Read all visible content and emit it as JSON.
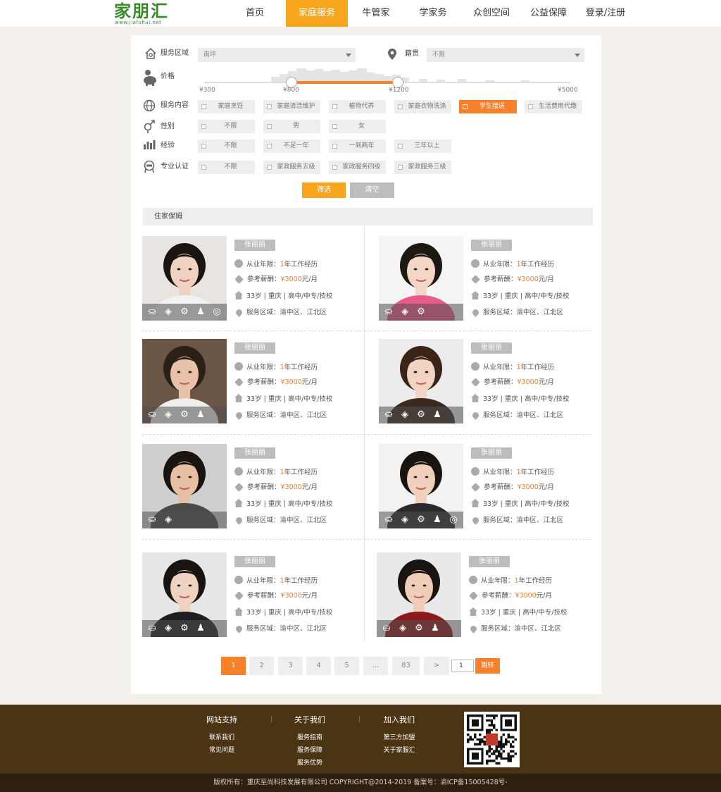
{
  "header": {
    "logo_text": "家朋汇",
    "logo_url": "www.jiafuhui.net",
    "nav": [
      {
        "label": "首页",
        "active": false
      },
      {
        "label": "家庭服务",
        "active": true
      },
      {
        "label": "牛管家",
        "active": false
      },
      {
        "label": "学家务",
        "active": false
      },
      {
        "label": "众创空间",
        "active": false
      },
      {
        "label": "公益保障",
        "active": false
      },
      {
        "label": "登录/注册",
        "active": false
      }
    ]
  },
  "filters": {
    "area": {
      "label": "服务区域",
      "value": "南坪"
    },
    "origin": {
      "label": "籍贯",
      "value": "不限"
    },
    "price": {
      "label": "价格",
      "ticks": [
        "¥300",
        "¥800",
        "¥1200",
        "¥5000"
      ],
      "min": 300,
      "max": 5000,
      "low": 800,
      "high": 1200
    },
    "content": {
      "label": "服务内容",
      "options": [
        "家庭烹饪",
        "家庭清洁维护",
        "植物代养",
        "家庭衣物洗涤",
        "学生接送",
        "生活费用代缴"
      ],
      "selected": "学生接送"
    },
    "gender": {
      "label": "性别",
      "options": [
        "不限",
        "男",
        "女"
      ]
    },
    "experience": {
      "label": "经验",
      "options": [
        "不限",
        "不足一年",
        "一到两年",
        "三年以上"
      ]
    },
    "certification": {
      "label": "专业认证",
      "options": [
        "不限",
        "家政服务五级",
        "家政服务四级",
        "家政服务三级"
      ]
    },
    "filter_button": "筛选",
    "clear_button": "清空"
  },
  "section_title": "住家保姆",
  "labels": {
    "years_prefix": "从业年限：",
    "years_value": "1",
    "years_suffix": "年工作经历",
    "salary_prefix": "参考薪酬：",
    "salary_value": "¥3000",
    "salary_suffix": "元/月",
    "profile": "33岁 | 重庆 | 高中/中专/技校",
    "area_prefix": "服务区域：",
    "area_value": "渝中区、江北区"
  },
  "cards": [
    {
      "name": "张丽丽",
      "bg": "#e8e4df",
      "hair": "#1a1410",
      "cloth": "#f2f2f2",
      "skin": "#f0d2c0",
      "icons": 5
    },
    {
      "name": "张丽丽",
      "bg": "#f4f4f4",
      "hair": "#1e1812",
      "cloth": "#e85a8a",
      "skin": "#f3d6c5",
      "icons": 3
    },
    {
      "name": "张丽丽",
      "bg": "#6b5646",
      "hair": "#2b2018",
      "cloth": "#f0eeea",
      "skin": "#e8c2a8",
      "icons": 4
    },
    {
      "name": "张丽丽",
      "bg": "#ececec",
      "hair": "#3a2418",
      "cloth": "#3b2a1e",
      "skin": "#f2d4c2",
      "icons": 4
    },
    {
      "name": "张丽丽",
      "bg": "#cfcfcf",
      "hair": "#1a1410",
      "cloth": "#4a4a4a",
      "skin": "#e6bfa4",
      "icons": 2
    },
    {
      "name": "张丽丽",
      "bg": "#f2f2f2",
      "hair": "#1a1410",
      "cloth": "#2a2a2e",
      "skin": "#f0d0bd",
      "icons": 5
    },
    {
      "name": "张丽丽",
      "bg": "#e6e6e6",
      "hair": "#1a1410",
      "cloth": "#1f1f22",
      "skin": "#f0d2c0",
      "icons": 4
    },
    {
      "name": "张丽丽",
      "bg": "#e9e9e9",
      "hair": "#1a1410",
      "cloth": "#8c1a1a",
      "skin": "#efcdb8",
      "icons": 4
    }
  ],
  "pagination": {
    "pages": [
      "1",
      "2",
      "3",
      "4",
      "5",
      "...",
      "83",
      ">"
    ],
    "current": "1",
    "input_value": "1",
    "go_label": "跳转"
  },
  "footer": {
    "columns": [
      {
        "title": "网站支持",
        "links": [
          "联系我们",
          "常见问题"
        ]
      },
      {
        "title": "关于我们",
        "links": [
          "服务指南",
          "服务保障",
          "服务优势"
        ]
      },
      {
        "title": "加入我们",
        "links": [
          "第三方加盟",
          "关于家服汇"
        ]
      }
    ],
    "copyright": "版权所有：重庆至尚科技发展有限公司 COPYRIGHT@2014-2019 备案号：渝ICP备15005428号-"
  },
  "colors": {
    "accent": "#f7a51c",
    "orange": "#f7802b",
    "footer_bg": "#4a3414",
    "copyright_bg": "#2f2110"
  }
}
